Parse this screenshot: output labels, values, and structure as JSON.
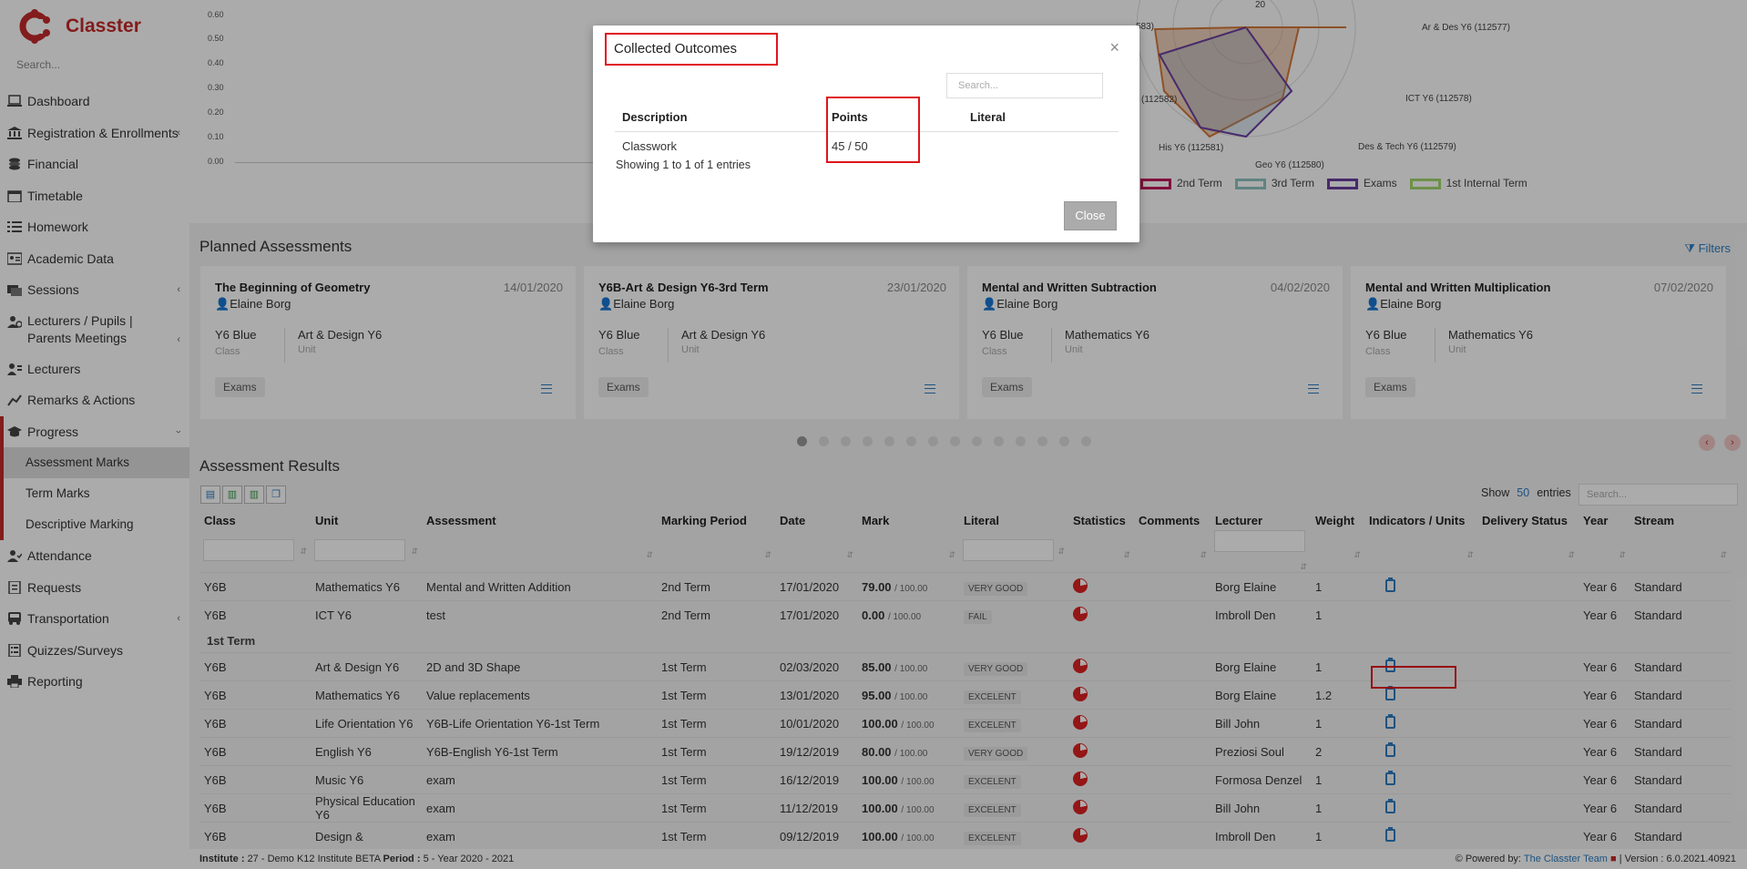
{
  "app": {
    "name": "Classter",
    "search_placeholder": "Search..."
  },
  "sidebar": {
    "items": [
      {
        "label": "Dashboard",
        "icon": "laptop-icon"
      },
      {
        "label": "Registration & Enrollments",
        "icon": "institution-icon",
        "chevron": "‹"
      },
      {
        "label": "Financial",
        "icon": "coins-icon"
      },
      {
        "label": "Timetable",
        "icon": "calendar-icon"
      },
      {
        "label": "Homework",
        "icon": "tasks-icon"
      },
      {
        "label": "Academic Data",
        "icon": "id-card-icon"
      },
      {
        "label": "Sessions",
        "icon": "sessions-icon",
        "chevron": "‹"
      },
      {
        "label": "Lecturers / Pupils | Parents Meetings",
        "icon": "users-gear-icon",
        "chevron": "‹"
      },
      {
        "label": "Lecturers",
        "icon": "lecturers-icon"
      },
      {
        "label": "Remarks & Actions",
        "icon": "remarks-icon"
      }
    ],
    "progress": {
      "label": "Progress",
      "icon": "graduation-cap-icon",
      "chevron": "‹",
      "sub": [
        "Assessment Marks",
        "Term Marks",
        "Descriptive Marking"
      ]
    },
    "items2": [
      {
        "label": "Attendance",
        "icon": "attendance-icon"
      },
      {
        "label": "Requests",
        "icon": "requests-icon"
      },
      {
        "label": "Transportation",
        "icon": "bus-icon",
        "chevron": "‹"
      },
      {
        "label": "Quizzes/Surveys",
        "icon": "quiz-icon"
      },
      {
        "label": "Reporting",
        "icon": "printer-icon"
      }
    ]
  },
  "chart": {
    "yticks": [
      "0.60",
      "0.50",
      "0.40",
      "0.30",
      "0.20",
      "0.10",
      "0.00"
    ],
    "radar_labels": [
      "583)",
      "20",
      "Ar & Des Y6 (112577)",
      "ICT Y6 (112578)",
      "(112582)",
      "Des & Tech Y6 (112579)",
      "His Y6 (112581)",
      "Geo Y6 (112580)"
    ],
    "legend": [
      {
        "label": "2nd Term",
        "color": "#c2185b"
      },
      {
        "label": "3rd Term",
        "color": "#8fc4c4"
      },
      {
        "label": "Exams",
        "color": "#6b3fa0"
      },
      {
        "label": "1st Internal Term",
        "color": "#a5d76e"
      }
    ]
  },
  "planned": {
    "title": "Planned Assessments",
    "filters_label": "Filters",
    "cards": [
      {
        "title": "The Beginning of Geometry",
        "date": "14/01/2020",
        "lecturer": "Elaine Borg",
        "class": "Y6 Blue",
        "class_label": "Class",
        "unit": "Art & Design Y6",
        "unit_label": "Unit",
        "tag": "Exams"
      },
      {
        "title": "Y6B-Art & Design Y6-3rd Term",
        "date": "23/01/2020",
        "lecturer": "Elaine Borg",
        "class": "Y6 Blue",
        "class_label": "Class",
        "unit": "Art & Design Y6",
        "unit_label": "Unit",
        "tag": "Exams"
      },
      {
        "title": "Mental and Written Subtraction",
        "date": "04/02/2020",
        "lecturer": "Elaine Borg",
        "class": "Y6 Blue",
        "class_label": "Class",
        "unit": "Mathematics Y6",
        "unit_label": "Unit",
        "tag": "Exams"
      },
      {
        "title": "Mental and Written Multiplication",
        "date": "07/02/2020",
        "lecturer": "Elaine Borg",
        "class": "Y6 Blue",
        "class_label": "Class",
        "unit": "Mathematics Y6",
        "unit_label": "Unit",
        "tag": "Exams"
      }
    ],
    "pager_dots": 14,
    "pager_active": 1
  },
  "results": {
    "title": "Assessment Results",
    "show_label": "Show",
    "show_count": "50",
    "entries_label": "entries",
    "search_placeholder": "Search...",
    "columns": [
      "Class",
      "Unit",
      "Assessment",
      "Marking Period",
      "Date",
      "Mark",
      "Literal",
      "Statistics",
      "Comments",
      "Lecturer",
      "Weight",
      "Indicators / Units",
      "Delivery Status",
      "Year",
      "Stream"
    ],
    "rows_top": [
      {
        "class": "Y6B",
        "unit": "Mathematics Y6",
        "assessment": "Mental and Written Addition",
        "period": "2nd Term",
        "date": "17/01/2020",
        "mark": "79.00",
        "of": "/ 100.00",
        "literal": "VERY GOOD",
        "lecturer": "Borg Elaine",
        "weight": "1",
        "indicator": true,
        "year": "Year 6",
        "stream": "Standard"
      },
      {
        "class": "Y6B",
        "unit": "ICT Y6",
        "assessment": "test",
        "period": "2nd Term",
        "date": "17/01/2020",
        "mark": "0.00",
        "of": "/ 100.00",
        "literal": "FAIL",
        "lecturer": "Imbroll Den",
        "weight": "1",
        "indicator": false,
        "year": "Year 6",
        "stream": "Standard"
      }
    ],
    "group_label": "1st Term",
    "rows": [
      {
        "class": "Y6B",
        "unit": "Art & Design Y6",
        "assessment": "2D and 3D Shape",
        "period": "1st Term",
        "date": "02/03/2020",
        "mark": "85.00",
        "of": "/ 100.00",
        "literal": "VERY GOOD",
        "lecturer": "Borg Elaine",
        "weight": "1",
        "indicator": true,
        "year": "Year 6",
        "stream": "Standard"
      },
      {
        "class": "Y6B",
        "unit": "Mathematics Y6",
        "assessment": "Value replacements",
        "period": "1st Term",
        "date": "13/01/2020",
        "mark": "95.00",
        "of": "/ 100.00",
        "literal": "EXCELENT",
        "lecturer": "Borg Elaine",
        "weight": "1.2",
        "indicator": true,
        "year": "Year 6",
        "stream": "Standard"
      },
      {
        "class": "Y6B",
        "unit": "Life Orientation Y6",
        "assessment": "Y6B-Life Orientation Y6-1st Term",
        "period": "1st Term",
        "date": "10/01/2020",
        "mark": "100.00",
        "of": "/ 100.00",
        "literal": "EXCELENT",
        "lecturer": "Bill John",
        "weight": "1",
        "indicator": true,
        "year": "Year 6",
        "stream": "Standard"
      },
      {
        "class": "Y6B",
        "unit": "English Y6",
        "assessment": "Y6B-English Y6-1st Term",
        "period": "1st Term",
        "date": "19/12/2019",
        "mark": "80.00",
        "of": "/ 100.00",
        "literal": "VERY GOOD",
        "lecturer": "Preziosi Soul",
        "weight": "2",
        "indicator": true,
        "year": "Year 6",
        "stream": "Standard"
      },
      {
        "class": "Y6B",
        "unit": "Music Y6",
        "assessment": "exam",
        "period": "1st Term",
        "date": "16/12/2019",
        "mark": "100.00",
        "of": "/ 100.00",
        "literal": "EXCELENT",
        "lecturer": "Formosa Denzel",
        "weight": "1",
        "indicator": true,
        "year": "Year 6",
        "stream": "Standard"
      },
      {
        "class": "Y6B",
        "unit": "Physical Education Y6",
        "assessment": "exam",
        "period": "1st Term",
        "date": "11/12/2019",
        "mark": "100.00",
        "of": "/ 100.00",
        "literal": "EXCELENT",
        "lecturer": "Bill John",
        "weight": "1",
        "indicator": true,
        "year": "Year 6",
        "stream": "Standard"
      },
      {
        "class": "Y6B",
        "unit": "Design &",
        "assessment": "exam",
        "period": "1st Term",
        "date": "09/12/2019",
        "mark": "100.00",
        "of": "/ 100.00",
        "literal": "EXCELENT",
        "lecturer": "Imbroll Den",
        "weight": "1",
        "indicator": true,
        "year": "Year 6",
        "stream": "Standard"
      }
    ]
  },
  "footer": {
    "institute_label": "Institute :",
    "institute": "27 - Demo K12 Institute BETA",
    "period_label": "Period :",
    "period": "5 - Year 2020 - 2021",
    "powered_by": "Powered by:",
    "team": "The Classter Team",
    "version": "| Version : 6.0.2021.40921"
  },
  "modal": {
    "title": "Collected Outcomes",
    "search_placeholder": "Search...",
    "columns": [
      "Description",
      "Points",
      "Literal"
    ],
    "rows": [
      {
        "description": "Classwork",
        "points": "45 / 50",
        "literal": ""
      }
    ],
    "info": "Showing 1 to 1 of 1 entries",
    "close_label": "Close",
    "close_x": "×"
  }
}
